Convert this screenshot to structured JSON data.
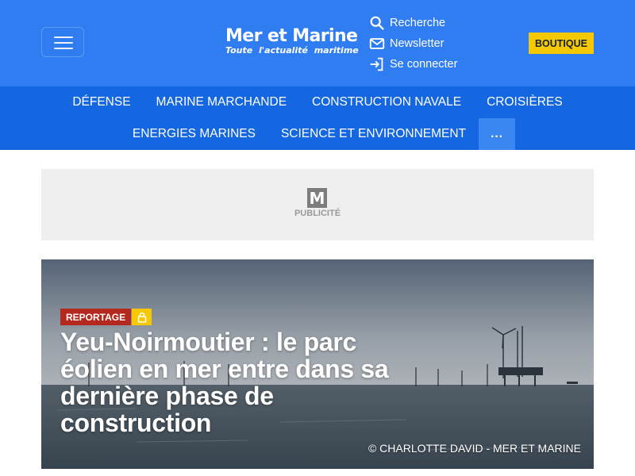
{
  "header": {
    "logo": {
      "title": "Mer et Marine",
      "tagline": "Toute l'actualité maritime"
    },
    "links": [
      {
        "label": "Recherche",
        "icon": "search-icon"
      },
      {
        "label": "Newsletter",
        "icon": "mail-icon"
      },
      {
        "label": "Se connecter",
        "icon": "login-icon"
      }
    ],
    "boutique_label": "BOUTIQUE",
    "colors": {
      "header_bg": "#2f7df0",
      "nav_bg": "#1467e0",
      "accent": "#f5c800",
      "badge_red": "#b4281e"
    }
  },
  "nav": {
    "row1": [
      "DÉFENSE",
      "MARINE MARCHANDE",
      "CONSTRUCTION NAVALE",
      "CROISIÈRES"
    ],
    "row2": [
      "ENERGIES MARINES",
      "SCIENCE ET ENVIRONNEMENT"
    ],
    "more_label": "..."
  },
  "ad": {
    "logo_letter": "M",
    "label": "PUBLICITÉ"
  },
  "hero": {
    "category": "REPORTAGE",
    "headline": "Yeu-Noirmoutier : le parc éolien en mer entre dans sa dernière phase de construction",
    "credit": "© CHARLOTTE DAVID - MER ET MARINE"
  }
}
